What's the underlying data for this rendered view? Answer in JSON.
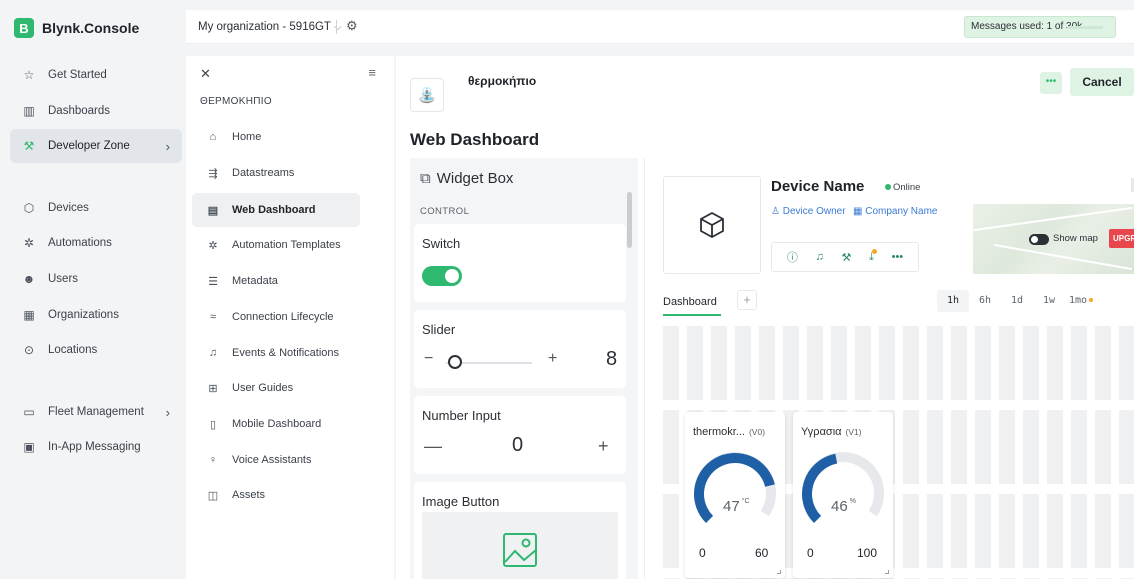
{
  "brand": {
    "logo_letter": "B",
    "name": "Blynk.Console"
  },
  "sidebar": {
    "items": [
      {
        "label": "Get Started",
        "icon": "star-icon"
      },
      {
        "label": "Dashboards",
        "icon": "bar-chart-icon"
      },
      {
        "label": "Developer Zone",
        "icon": "tools-icon"
      },
      {
        "label": "Devices",
        "icon": "cube-icon"
      },
      {
        "label": "Automations",
        "icon": "sparkle-icon"
      },
      {
        "label": "Users",
        "icon": "users-icon"
      },
      {
        "label": "Organizations",
        "icon": "building-icon"
      },
      {
        "label": "Locations",
        "icon": "location-pin-icon"
      },
      {
        "label": "Fleet Management",
        "icon": "fleet-icon"
      },
      {
        "label": "In-App Messaging",
        "icon": "message-icon"
      }
    ]
  },
  "topbar": {
    "org_label": "My organization - 5916GT",
    "messages_used": "Messages used: 1 of 30k"
  },
  "subnav": {
    "title": "ΘΕΡΜΟΚΗΠΙΟ",
    "items": [
      {
        "label": "Home",
        "icon": "home-icon"
      },
      {
        "label": "Datastreams",
        "icon": "datastreams-icon"
      },
      {
        "label": "Web Dashboard",
        "icon": "dashboard-icon"
      },
      {
        "label": "Automation Templates",
        "icon": "automation-icon"
      },
      {
        "label": "Metadata",
        "icon": "list-icon"
      },
      {
        "label": "Connection Lifecycle",
        "icon": "wifi-icon"
      },
      {
        "label": "Events & Notifications",
        "icon": "bell-icon"
      },
      {
        "label": "User Guides",
        "icon": "book-icon"
      },
      {
        "label": "Mobile Dashboard",
        "icon": "mobile-icon"
      },
      {
        "label": "Voice Assistants",
        "icon": "microphone-icon"
      },
      {
        "label": "Assets",
        "icon": "assets-icon"
      }
    ]
  },
  "main": {
    "template_name": "θερμοκήπιο",
    "cancel_label": "Cancel",
    "more_label": "•••",
    "page_title": "Web Dashboard"
  },
  "widget_box": {
    "title": "Widget Box",
    "section": "CONTROL",
    "widgets": {
      "switch": {
        "title": "Switch",
        "state": "on"
      },
      "slider": {
        "title": "Slider",
        "value": "8",
        "level": 0.1
      },
      "number_input": {
        "title": "Number Input",
        "value": "0",
        "minus": "—",
        "plus": "+"
      },
      "image_button": {
        "title": "Image Button"
      }
    }
  },
  "device": {
    "name": "Device Name",
    "status": "Online",
    "owner": "Device Owner",
    "company": "Company Name",
    "map_label": "Show map",
    "map_upgrade": "UPGR"
  },
  "dashboard": {
    "tab": "Dashboard",
    "add_label": "+",
    "ranges": [
      "1h",
      "6h",
      "1d",
      "1w",
      "1mo"
    ],
    "active_range": "1h",
    "gauges": [
      {
        "title": "thermokr...",
        "pin": "(V0)",
        "value": "47",
        "unit": "°C",
        "min": "0",
        "max": "60",
        "level": 0.783
      },
      {
        "title": "Υγρασια",
        "pin": "(V1)",
        "value": "46",
        "unit": "%",
        "min": "0",
        "max": "100",
        "level": 0.46
      }
    ]
  },
  "colors": {
    "accent": "#2fb86f",
    "gauge": "#1f5fa6",
    "link": "#3a7bd5",
    "upgrade": "#e8454d"
  }
}
